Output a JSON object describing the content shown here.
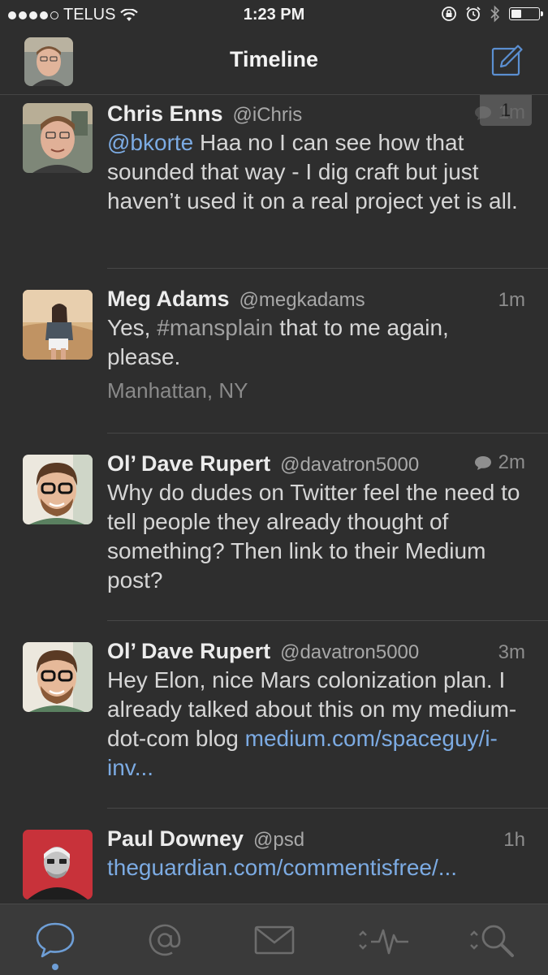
{
  "status_bar": {
    "carrier": "TELUS",
    "time": "1:23 PM",
    "signal_bars": 4,
    "signal_total": 5,
    "battery_level": 0.35
  },
  "nav": {
    "title": "Timeline",
    "compose_icon": "compose-icon",
    "accent_color": "#5b8fd1"
  },
  "tweets": [
    {
      "name": "Chris Enns",
      "handle": "@iChris",
      "time": "1m",
      "mention": "@bkorte",
      "text": " Haa no I can see how that sounded that way - I dig craft but just haven’t used it on a real project yet is all.",
      "badge": "1",
      "has_reply_icon": true
    },
    {
      "name": "Meg Adams",
      "handle": "@megkadams",
      "time": "1m",
      "text_before": "Yes, ",
      "hashtag": "#mansplain",
      "text_after": " that to me again, please.",
      "location": "Manhattan, NY"
    },
    {
      "name": "Ol’ Dave Rupert",
      "handle": "@davatron5000",
      "time": "2m",
      "text": "Why do dudes on Twitter feel the need to tell people they already thought of something? Then link to their Medium post?",
      "has_reply_icon": true
    },
    {
      "name": "Ol’ Dave Rupert",
      "handle": "@davatron5000",
      "time": "3m",
      "text": "Hey Elon, nice Mars colonization plan. I already talked about this on my medium-dot-com blog ",
      "link": "medium.com/spaceguy/i-inv..."
    },
    {
      "name": "Paul Downey",
      "handle": "@psd",
      "time": "1h",
      "link": "theguardian.com/commentisfree/..."
    }
  ],
  "tab_bar": {
    "tabs": [
      {
        "icon": "chat-bubble-icon",
        "active": true
      },
      {
        "icon": "mention-icon",
        "active": false
      },
      {
        "icon": "mail-icon",
        "active": false
      },
      {
        "icon": "activity-icon",
        "active": false
      },
      {
        "icon": "search-icon",
        "active": false
      }
    ],
    "active_color": "#6e9ed6",
    "inactive_color": "#6d6d6d"
  }
}
